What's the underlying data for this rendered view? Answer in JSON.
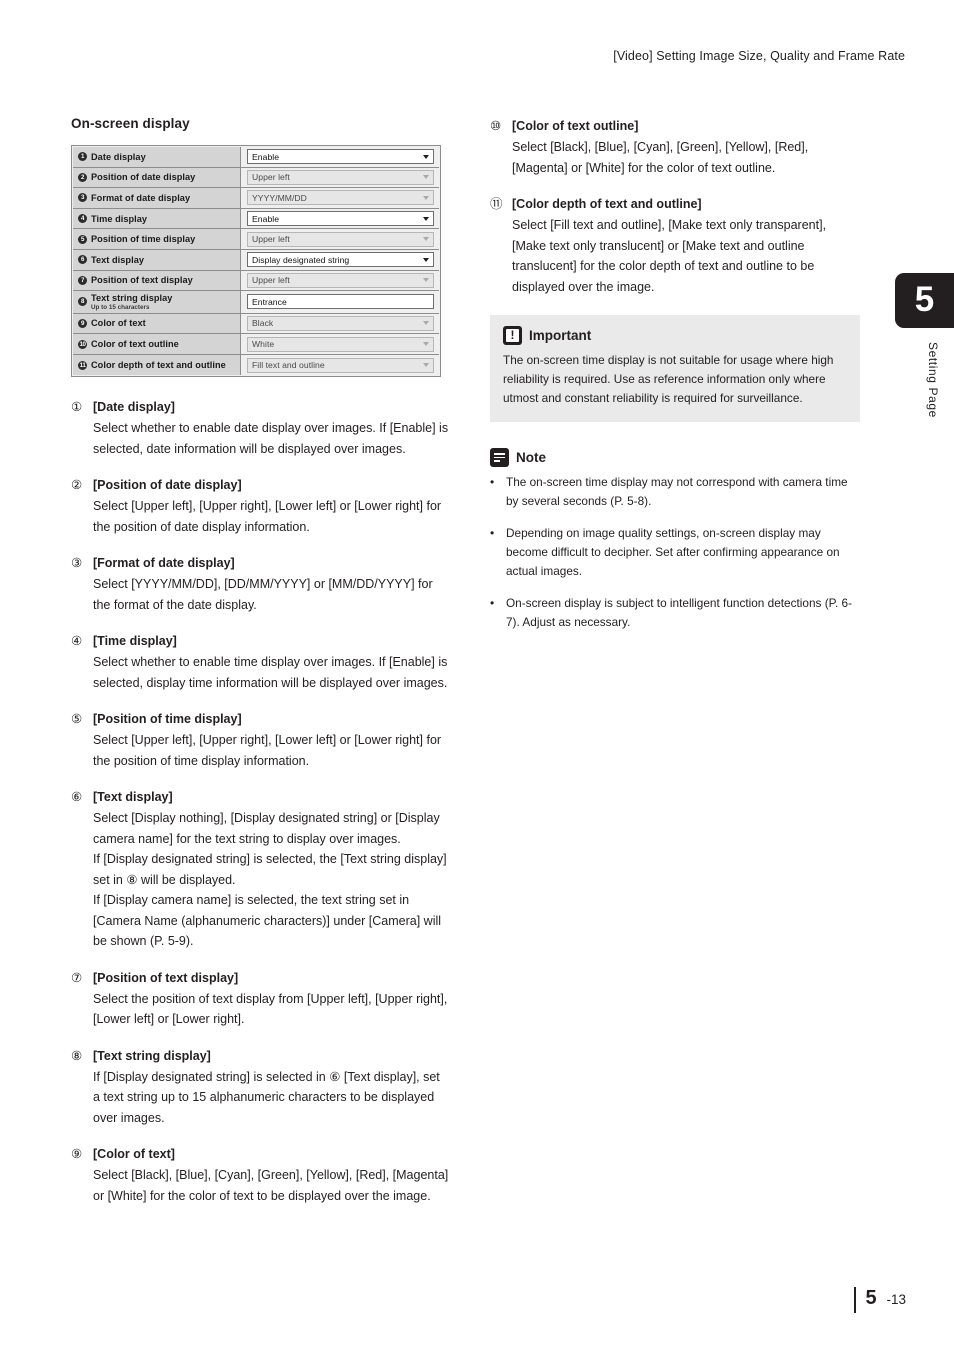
{
  "header": {
    "running_title": "[Video] Setting Image Size, Quality and Frame Rate"
  },
  "chapter_tab": {
    "number": "5",
    "label": "Setting Page"
  },
  "footer": {
    "chapter": "5",
    "page": "-13"
  },
  "left_column": {
    "section_title": "On-screen display",
    "settings_table": {
      "rows": [
        {
          "badge": "1",
          "label": "Date display",
          "sublabel": "",
          "value": "Enable",
          "control": "select",
          "state": "enabled"
        },
        {
          "badge": "2",
          "label": "Position of date display",
          "sublabel": "",
          "value": "Upper left",
          "control": "select",
          "state": "disabled"
        },
        {
          "badge": "3",
          "label": "Format of date display",
          "sublabel": "",
          "value": "YYYY/MM/DD",
          "control": "select",
          "state": "disabled"
        },
        {
          "badge": "4",
          "label": "Time display",
          "sublabel": "",
          "value": "Enable",
          "control": "select",
          "state": "enabled"
        },
        {
          "badge": "5",
          "label": "Position of time display",
          "sublabel": "",
          "value": "Upper left",
          "control": "select",
          "state": "disabled"
        },
        {
          "badge": "6",
          "label": "Text display",
          "sublabel": "",
          "value": "Display designated string",
          "control": "select",
          "state": "enabled"
        },
        {
          "badge": "7",
          "label": "Position of text display",
          "sublabel": "",
          "value": "Upper left",
          "control": "select",
          "state": "disabled"
        },
        {
          "badge": "8",
          "label": "Text string display",
          "sublabel": "Up to 15 characters",
          "value": "Entrance",
          "control": "text",
          "state": "enabled"
        },
        {
          "badge": "9",
          "label": "Color of text",
          "sublabel": "",
          "value": "Black",
          "control": "select",
          "state": "disabled"
        },
        {
          "badge": "10",
          "label": "Color of text outline",
          "sublabel": "",
          "value": "White",
          "control": "select",
          "state": "disabled"
        },
        {
          "badge": "11",
          "label": "Color depth of text and outline",
          "sublabel": "",
          "value": "Fill text and outline",
          "control": "select",
          "state": "disabled"
        }
      ]
    },
    "items": [
      {
        "num": "①",
        "title": "[Date display]",
        "paragraphs": [
          "Select whether to enable date display over images. If [Enable] is selected, date information will be displayed over images."
        ]
      },
      {
        "num": "②",
        "title": "[Position of date display]",
        "paragraphs": [
          "Select [Upper left], [Upper right], [Lower left] or [Lower right] for the position of date display information."
        ]
      },
      {
        "num": "③",
        "title": "[Format of date display]",
        "paragraphs": [
          "Select [YYYY/MM/DD], [DD/MM/YYYY] or [MM/DD/YYYY] for the format of the date display."
        ]
      },
      {
        "num": "④",
        "title": "[Time display]",
        "paragraphs": [
          "Select whether to enable time display over images. If [Enable] is selected, display time information will be displayed over images."
        ]
      },
      {
        "num": "⑤",
        "title": "[Position of time display]",
        "paragraphs": [
          "Select [Upper left], [Upper right], [Lower left] or [Lower right] for the position of time display information."
        ]
      },
      {
        "num": "⑥",
        "title": "[Text display]",
        "paragraphs": [
          "Select [Display nothing], [Display designated string] or [Display camera name] for the text string to display over images.",
          "If [Display designated string] is selected, the [Text string display] set in ⑧ will be displayed.",
          "If [Display camera name] is selected, the text string set in [Camera Name (alphanumeric characters)] under [Camera] will be shown (P. 5-9)."
        ]
      },
      {
        "num": "⑦",
        "title": "[Position of text display]",
        "paragraphs": [
          "Select the position of text display from [Upper left], [Upper right], [Lower left] or [Lower right]."
        ]
      },
      {
        "num": "⑧",
        "title": "[Text string display]",
        "paragraphs": [
          "If [Display designated string] is selected in ⑥ [Text display], set a text string up to 15 alphanumeric characters to be displayed over images."
        ]
      },
      {
        "num": "⑨",
        "title": "[Color of text]",
        "paragraphs": [
          "Select [Black], [Blue], [Cyan], [Green], [Yellow], [Red], [Magenta] or [White] for the color of text to be displayed over the image."
        ]
      }
    ]
  },
  "right_column": {
    "items": [
      {
        "num": "⑩",
        "title": "[Color of text outline]",
        "paragraphs": [
          "Select [Black], [Blue], [Cyan], [Green], [Yellow], [Red], [Magenta] or [White] for the color of text outline."
        ]
      },
      {
        "num": "⑪",
        "title": "[Color depth of text and outline]",
        "paragraphs": [
          "Select [Fill text and outline], [Make text only transparent], [Make text only translucent] or [Make text and outline translucent] for the color depth of text and outline to be displayed over the image."
        ]
      }
    ],
    "important": {
      "title": "Important",
      "text": "The on-screen time display is not suitable for usage where high reliability is required. Use as reference information only where utmost and constant reliability is required for surveillance."
    },
    "note": {
      "title": "Note",
      "bullet_marker": "•",
      "bullets": [
        "The on-screen time display may not correspond with camera time by several seconds (P. 5-8).",
        "Depending on image quality settings, on-screen display may become difficult to decipher. Set after confirming appearance on actual images.",
        "On-screen display is subject to intelligent function detections (P. 6-7). Adjust as necessary."
      ]
    }
  },
  "colors": {
    "ink": "#231f20",
    "table_label_bg": "#d4d4d4",
    "table_value_bg": "#efefef",
    "notebox_bg": "#eaeaea"
  }
}
